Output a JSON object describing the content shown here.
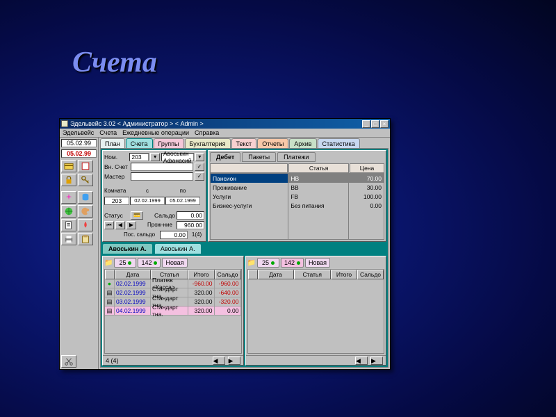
{
  "slide": {
    "title": "Счета"
  },
  "window": {
    "title": "Эдельвейс 3.02 < Администратор > < Admin >",
    "minimize": "_",
    "maximize": "□",
    "close": "×"
  },
  "menu": {
    "m1": "Эдельвейс",
    "m2": "Счета",
    "m3": "Ежедневные операции",
    "m4": "Справка"
  },
  "dates": {
    "primary": "05.02.99",
    "secondary": "05.02.99"
  },
  "tabs": {
    "t1": "План",
    "t2": "Счета",
    "t3": "Группы",
    "t4": "Бухгалтерия",
    "t5": "Текст",
    "t6": "Отчеты",
    "t7": "Архив",
    "t8": "Статистика"
  },
  "tab_colors": {
    "t1": "#e6f0f0",
    "t2": "#a0e0e0",
    "t3": "#f4c8d8",
    "t4": "#e8e8c8",
    "t5": "#f8d0d0",
    "t6": "#f8c8a8",
    "t7": "#c8e0c8",
    "t8": "#c8d8f0"
  },
  "form": {
    "nom_label": "Ном.",
    "nom_value": "203",
    "guest_value": "Авоськин Афанасий",
    "vn_label": "Вн. Счет",
    "vn_value": "",
    "master_label": "Мастер",
    "master_value": "",
    "room_label": "Комната",
    "from_label": "с",
    "to_label": "по",
    "room_value": "203",
    "from_value": "02.02.1999",
    "to_value": "05.02.1999",
    "status_label": "Статус",
    "status_icon": "💳",
    "saldo_label": "Сальдо",
    "saldo_value": "0.00",
    "proj_label": "Прож-ние",
    "proj_value": "960.00",
    "posaldo_label": "Пос. сальдо",
    "posaldo_value": "0.00",
    "count": "1(4)"
  },
  "svc": {
    "tabs": {
      "t1": "Дебет",
      "t2": "Пакеты",
      "t3": "Платежи"
    },
    "headers": {
      "h1": "",
      "h2": "Статья",
      "h3": "Цена"
    },
    "rows": [
      {
        "name": "Пансион",
        "article": "HB",
        "price": "70.00"
      },
      {
        "name": "Проживание",
        "article": "BB",
        "price": "30.00"
      },
      {
        "name": "Услуги",
        "article": "FB",
        "price": "100.00"
      },
      {
        "name": "Бизнес-услуги",
        "article": "Без питания",
        "price": "0.00"
      }
    ]
  },
  "guest_tabs": {
    "g1": "Авоськин А.",
    "g2": "Авоськин А."
  },
  "ledger": {
    "pills": {
      "p1": "25",
      "p2": "142",
      "p3": "Новая"
    },
    "headers": {
      "date": "Дата",
      "article": "Статья",
      "total": "Итого",
      "saldo": "Сальдо"
    },
    "left_rows": [
      {
        "icon": "●",
        "icon_color": "#0a0",
        "date": "02.02.1999",
        "article": "Платеж <Касса>",
        "total": "-960.00",
        "saldo": "-960.00"
      },
      {
        "icon": "▤",
        "icon_color": "#808080",
        "date": "02.02.1999",
        "article": "Стандарт тна.",
        "total": "320.00",
        "saldo": "-640.00"
      },
      {
        "icon": "▤",
        "icon_color": "#808080",
        "date": "03.02.1999",
        "article": "Стандарт тна.",
        "total": "320.00",
        "saldo": "-320.00"
      },
      {
        "icon": "▤",
        "icon_color": "#808080",
        "date": "04.02.1999",
        "article": "Стандарт тна.",
        "total": "320.00",
        "saldo": "0.00",
        "sel": true
      }
    ],
    "status_left": "4 (4)"
  }
}
